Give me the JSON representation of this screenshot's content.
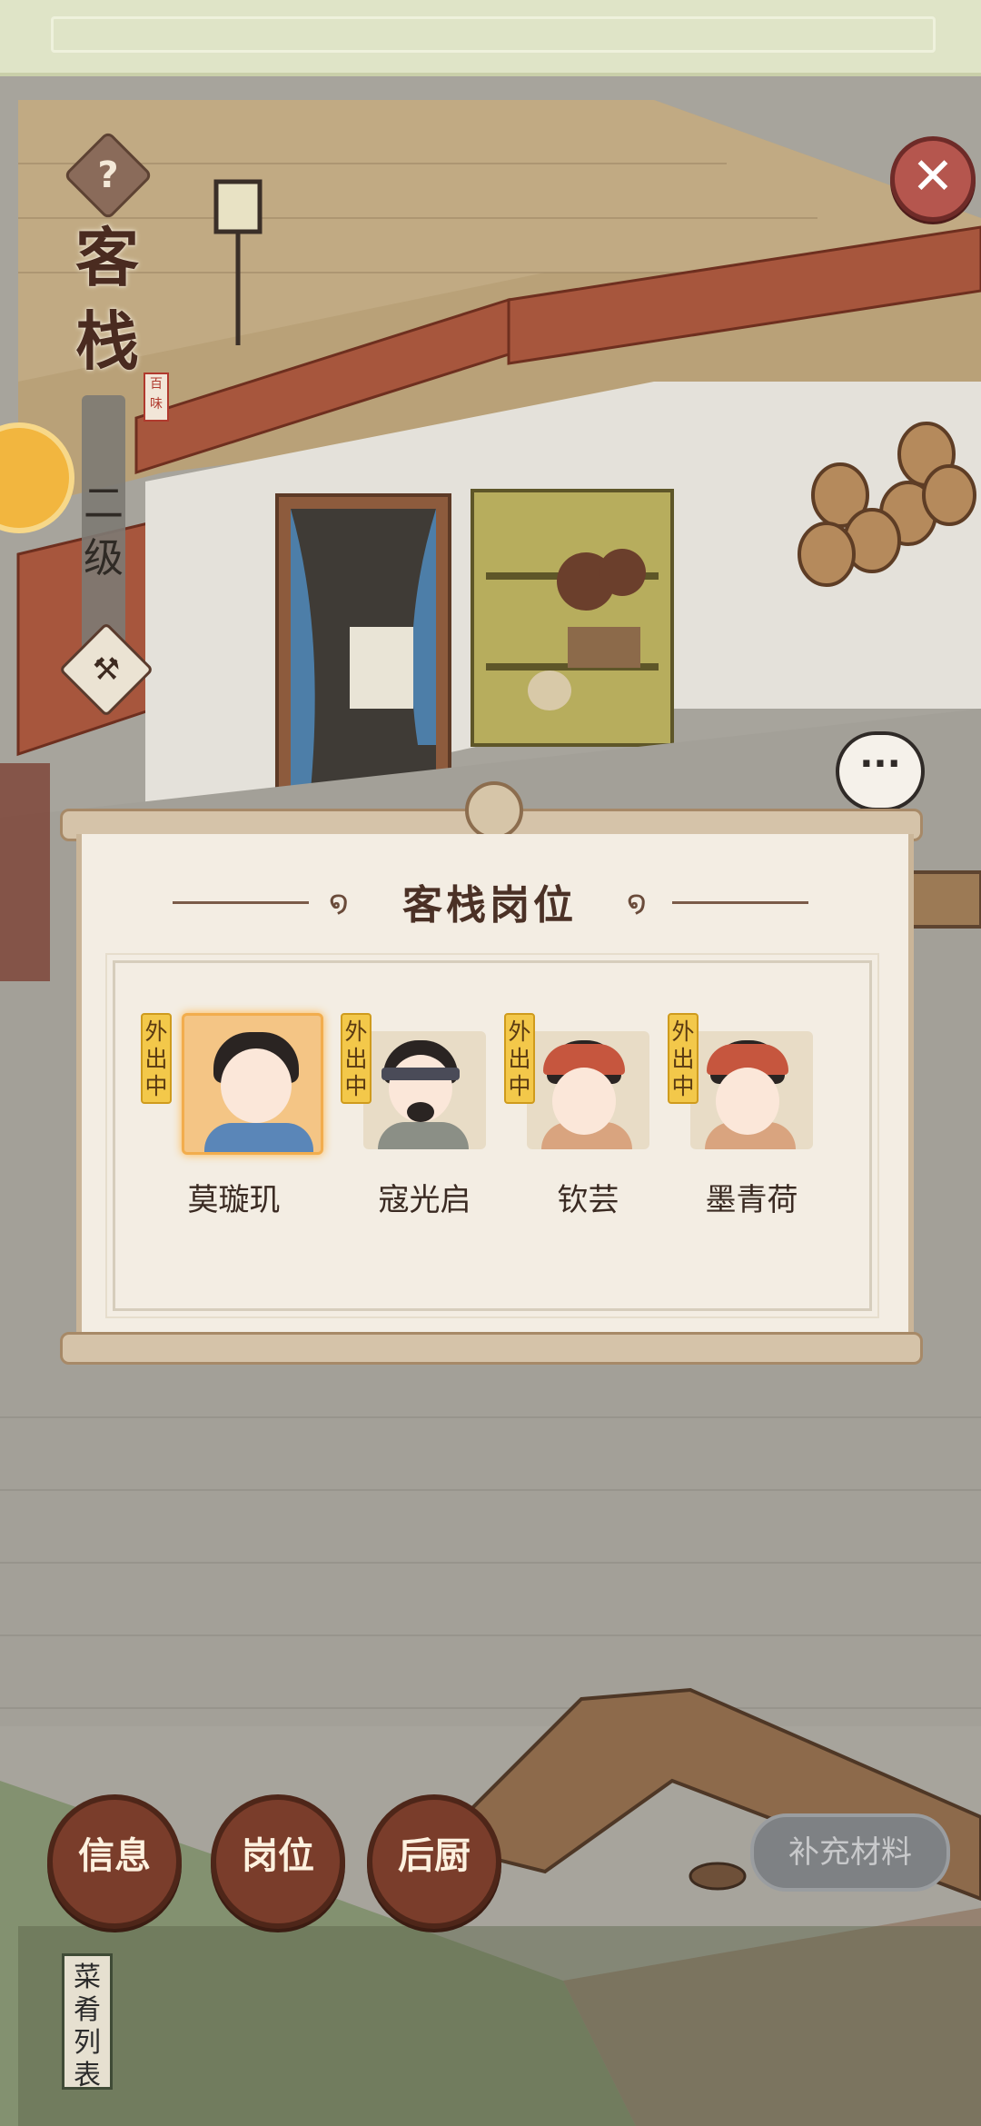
{
  "screen": {
    "title": "客栈",
    "seal": "百味",
    "level": "二级",
    "help_icon": "question-icon",
    "close_icon": "close-icon"
  },
  "dialog": {
    "title": "客栈岗位",
    "staff": [
      {
        "name": "莫璇玑",
        "status": "外出中",
        "active": true
      },
      {
        "name": "寇光启",
        "status": "外出中",
        "active": false
      },
      {
        "name": "钦芸",
        "status": "外出中",
        "active": false
      },
      {
        "name": "墨青荷",
        "status": "外出中",
        "active": false
      }
    ]
  },
  "buttons": {
    "info": "信息",
    "posts": "岗位",
    "kitchen": "后厨",
    "supply": "补充材料",
    "menu_tab": "菜肴列表"
  },
  "colors": {
    "accent_gold": "#f3c84a",
    "button_brown": "#7a3d2b",
    "close_red": "#b5564e"
  }
}
